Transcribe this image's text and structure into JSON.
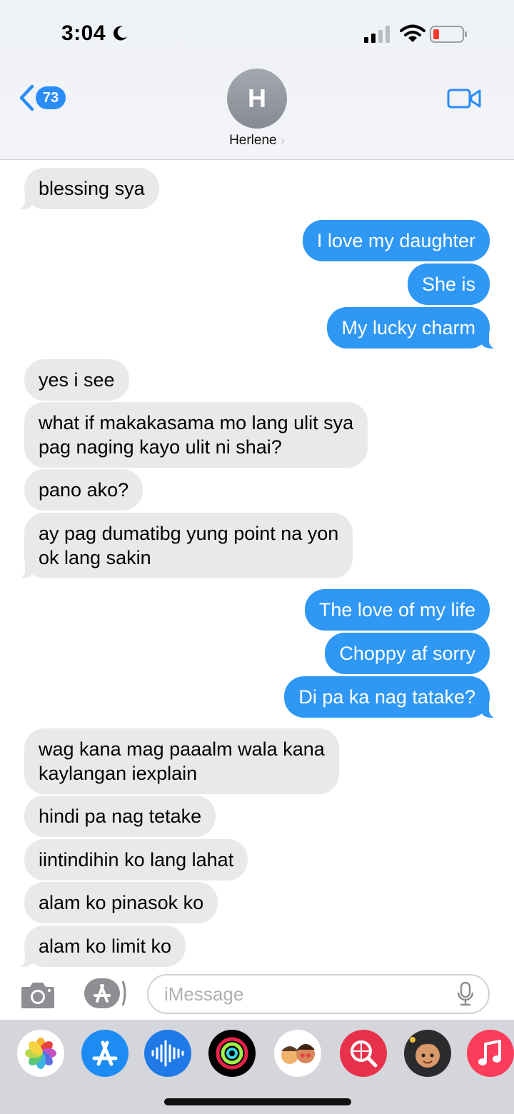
{
  "status_bar": {
    "time": "3:04"
  },
  "header": {
    "back_badge": "73",
    "avatar_initial": "H",
    "contact_name": "Herlene",
    "name_chevron": "›"
  },
  "messages": [
    {
      "direction": "incoming",
      "text": "blessing sya"
    },
    {
      "direction": "outgoing",
      "text": "I love my daughter"
    },
    {
      "direction": "outgoing",
      "text": "She is"
    },
    {
      "direction": "outgoing",
      "text": "My lucky charm"
    },
    {
      "direction": "incoming",
      "text": "yes i see"
    },
    {
      "direction": "incoming",
      "text": "what if makakasama mo lang ulit sya\npag naging kayo ulit ni shai?"
    },
    {
      "direction": "incoming",
      "text": "pano ako?"
    },
    {
      "direction": "incoming",
      "text": "ay pag dumatibg yung point na yon\nok lang sakin"
    },
    {
      "direction": "outgoing",
      "text": "The love of my life"
    },
    {
      "direction": "outgoing",
      "text": "Choppy af sorry"
    },
    {
      "direction": "outgoing",
      "text": "Di pa ka nag tatake?"
    },
    {
      "direction": "incoming",
      "text": "wag kana mag paaalm wala kana\nkaylangan iexplain"
    },
    {
      "direction": "incoming",
      "text": "hindi pa nag tetake"
    },
    {
      "direction": "incoming",
      "text": "iintindihin ko lang lahat"
    },
    {
      "direction": "incoming",
      "text": "alam ko pinasok ko"
    },
    {
      "direction": "incoming",
      "text": "alam ko limit ko"
    }
  ],
  "input": {
    "placeholder": "iMessage"
  },
  "app_drawer": {
    "apps": [
      "photos-app",
      "app-store-app",
      "audio-message-app",
      "fitness-app",
      "memoji-stickers-app",
      "search-images-app",
      "memoji-app",
      "music-app"
    ]
  },
  "colors": {
    "outgoing_bubble": "#2f97f4",
    "incoming_bubble": "#e9e9eb",
    "accent": "#2a8cf6"
  }
}
